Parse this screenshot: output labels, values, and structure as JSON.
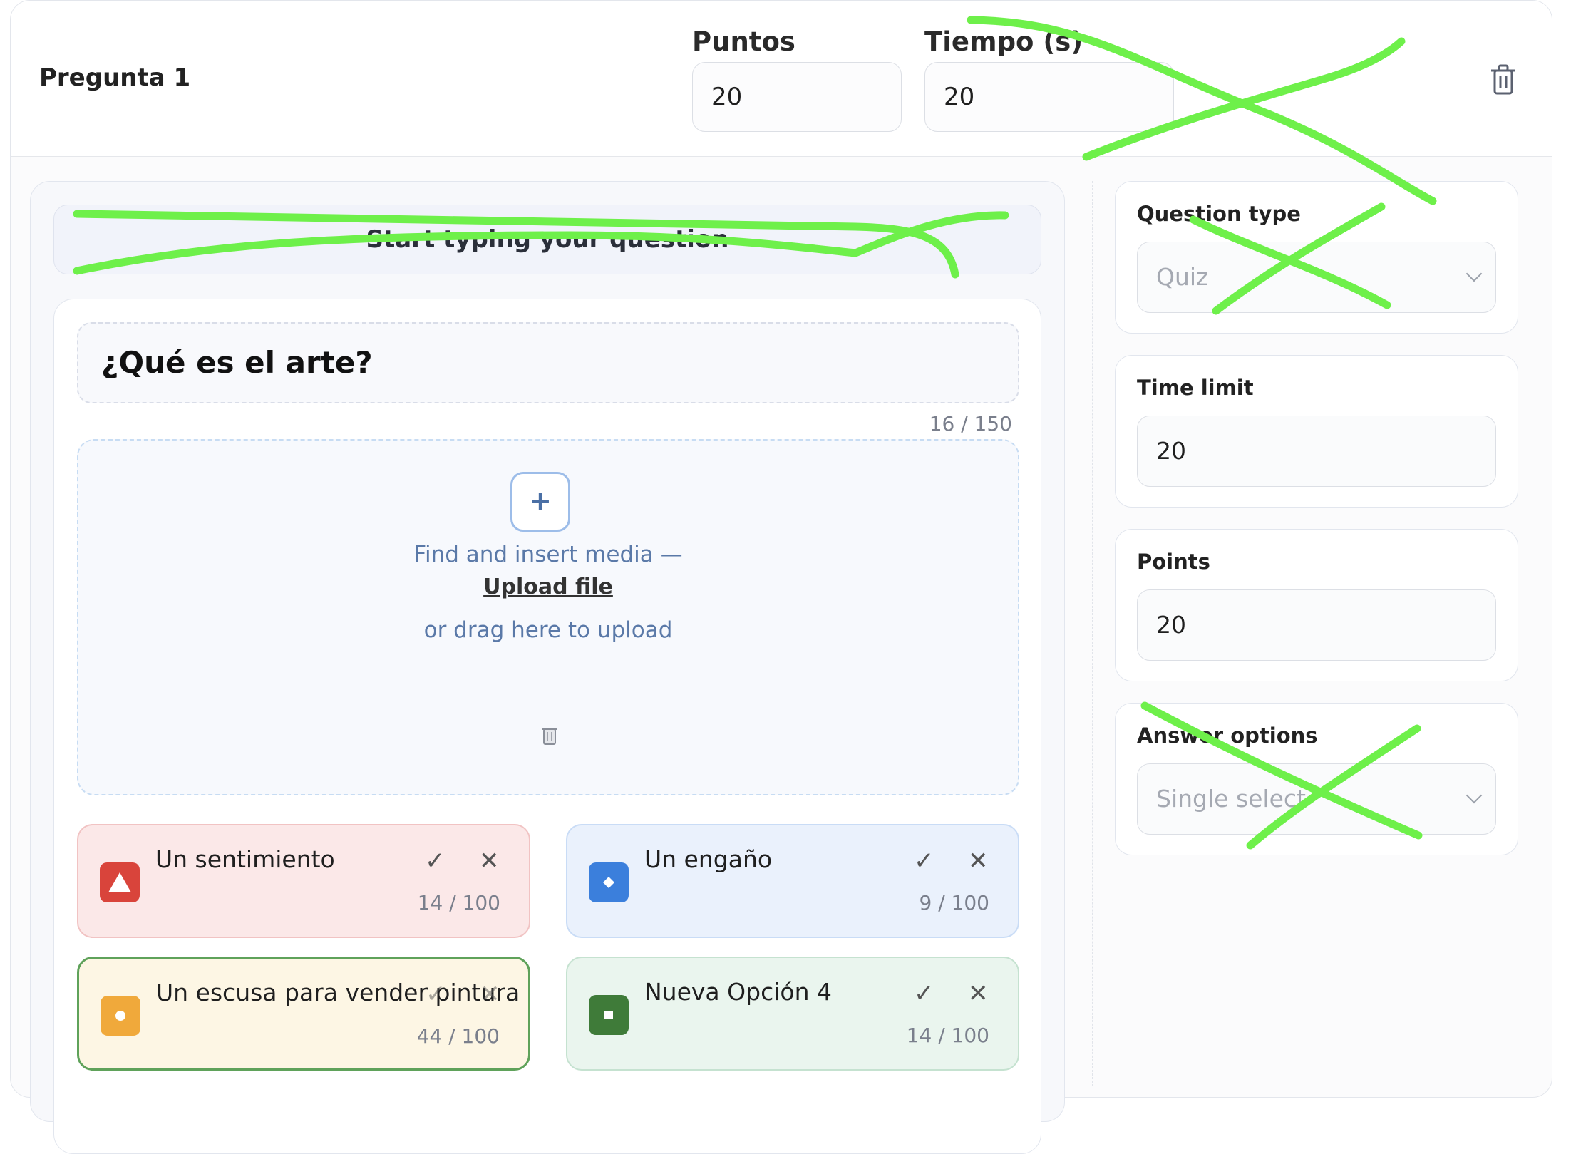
{
  "header": {
    "title": "Pregunta 1",
    "points_label": "Puntos",
    "points_value": "20",
    "time_label": "Tiempo (s)",
    "time_value": "20"
  },
  "editor": {
    "prompt_placeholder": "Start typing your question",
    "question_text": "¿Qué es el arte?",
    "question_counter": "16 / 150",
    "media": {
      "find_text": "Find and insert media —",
      "upload_link": "Upload file",
      "drag_text": "or drag here to upload"
    },
    "answers": [
      {
        "text": "Un sentimiento",
        "count": "14 / 100",
        "color": "#d9443b",
        "bg": "#fbe8e8",
        "border": "#f1c3c3",
        "icon": "triangle-icon"
      },
      {
        "text": "Un engaño",
        "count": "9 / 100",
        "color": "#3b7fdc",
        "bg": "#eaf1fc",
        "border": "#c9dcf6",
        "icon": "diamond-icon"
      },
      {
        "text": "Un escusa para vender pintura",
        "count": "44 / 100",
        "color": "#f0a93b",
        "bg": "#fdf6e4",
        "border": "#5fa25a",
        "icon": "circle-icon"
      },
      {
        "text": "Nueva Opción 4",
        "count": "14 / 100",
        "color": "#3f7b39",
        "bg": "#eaf5ee",
        "border": "#c5e2d0",
        "icon": "square-icon"
      }
    ]
  },
  "sidebar": {
    "question_type_label": "Question type",
    "question_type_value": "Quiz",
    "time_limit_label": "Time limit",
    "time_limit_value": "20",
    "points_label": "Points",
    "points_value": "20",
    "answer_options_label": "Answer options",
    "answer_options_value": "Single select"
  },
  "annotation_color": "#6ef04a"
}
